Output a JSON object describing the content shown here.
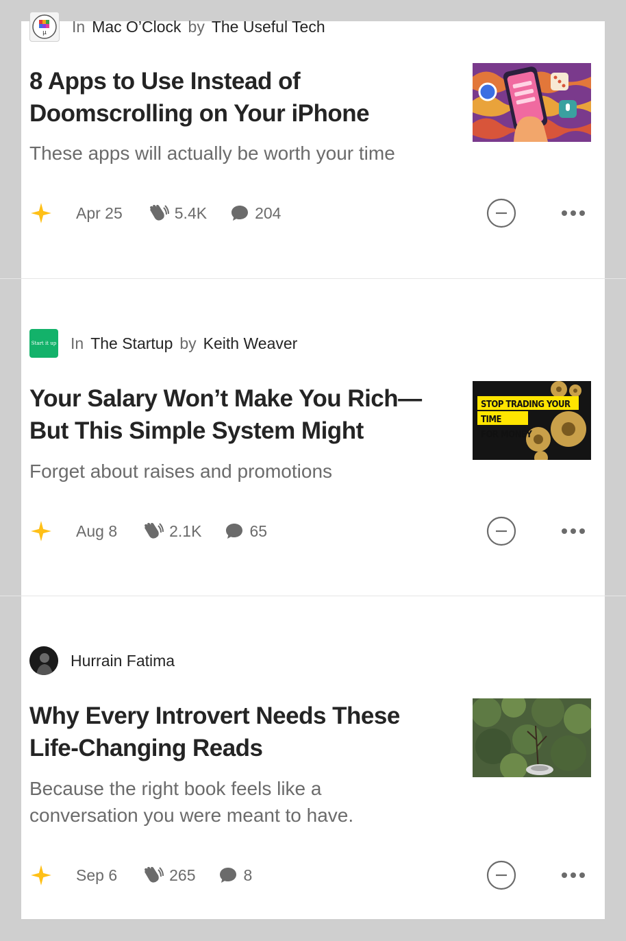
{
  "articles": [
    {
      "in_label": "In",
      "publication": "Mac O’Clock",
      "by_label": "by",
      "author": "The Useful Tech",
      "title": "8 Apps to Use Instead of Doomscrolling on Your iPhone",
      "subtitle": "These apps will actually be worth your time",
      "date": "Apr 25",
      "claps": "5.4K",
      "responses": "204",
      "logo_icon": "clock-logo-icon",
      "thumbnail": "phone-apps-illustration"
    },
    {
      "in_label": "In",
      "publication": "The Startup",
      "by_label": "by",
      "author": "Keith Weaver",
      "title": "Your Salary Won’t Make You Rich—But This Simple System Might",
      "subtitle": "Forget about raises and promotions",
      "date": "Aug 8",
      "claps": "2.1K",
      "responses": "65",
      "logo_text": "Start it up",
      "thumbnail_text_line1": "STOP TRADING YOUR TIME",
      "thumbnail_text_line2": "FOR MONEY",
      "thumbnail": "gears-illustration"
    },
    {
      "author": "Hurrain Fatima",
      "title": "Why Every Introvert Needs These Life-Changing Reads",
      "subtitle": "Because the right book feels like a conversation you were meant to have.",
      "date": "Sep 6",
      "claps": "265",
      "responses": "8",
      "thumbnail": "plant-photo"
    }
  ],
  "colors": {
    "member_star": "#ffc017",
    "startup_green": "#13b26a",
    "text_primary": "#242424",
    "text_muted": "#6b6b6b"
  },
  "icons": [
    "star-icon",
    "clap-icon",
    "comment-icon",
    "show-less-icon",
    "more-icon"
  ]
}
